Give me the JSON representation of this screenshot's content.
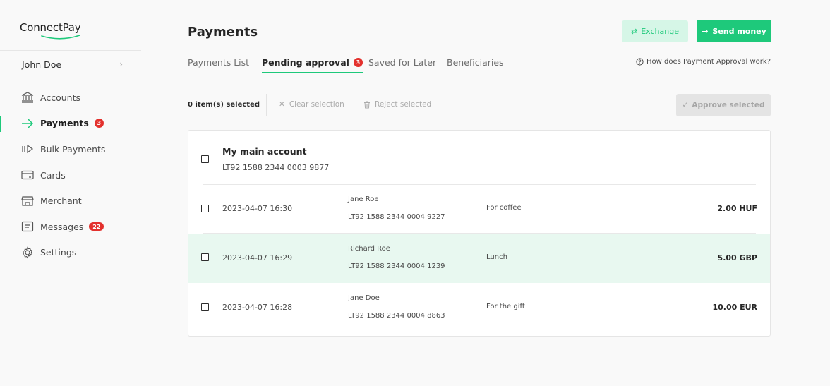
{
  "app": {
    "brand": "ConnectPay"
  },
  "user": {
    "name": "John Doe"
  },
  "sidebar": {
    "items": [
      {
        "label": "Accounts",
        "icon": "bank-icon"
      },
      {
        "label": "Payments",
        "icon": "arrow-right-icon",
        "badge": "3",
        "active": true
      },
      {
        "label": "Bulk Payments",
        "icon": "bulk-arrow-icon"
      },
      {
        "label": "Cards",
        "icon": "card-icon"
      },
      {
        "label": "Merchant",
        "icon": "store-icon"
      },
      {
        "label": "Messages",
        "icon": "message-icon",
        "badge": "22"
      },
      {
        "label": "Settings",
        "icon": "gear-icon"
      }
    ]
  },
  "header": {
    "title": "Payments",
    "exchange_label": "Exchange",
    "send_label": "Send money"
  },
  "tabs": [
    {
      "label": "Payments List"
    },
    {
      "label": "Pending approval",
      "badge": "3",
      "active": true
    },
    {
      "label": "Saved for Later"
    },
    {
      "label": "Beneficiaries"
    }
  ],
  "help_link": "How does Payment Approval work?",
  "toolbar": {
    "selected_count": "0 item(s) selected",
    "clear_label": "Clear selection",
    "reject_label": "Reject selected",
    "approve_label": "Approve selected"
  },
  "account": {
    "name": "My main account",
    "iban": "LT92 1588 2344 0003 9877"
  },
  "payments": [
    {
      "datetime": "2023-04-07 16:30",
      "beneficiary": "Jane Roe",
      "iban": "LT92 1588 2344 0004 9227",
      "description": "For coffee",
      "amount": "2.00 HUF"
    },
    {
      "datetime": "2023-04-07 16:29",
      "beneficiary": "Richard Roe",
      "iban": "LT92 1588 2344 0004 1239",
      "description": "Lunch",
      "amount": "5.00 GBP",
      "highlighted": true
    },
    {
      "datetime": "2023-04-07 16:28",
      "beneficiary": "Jane Doe",
      "iban": "LT92 1588 2344 0004 8863",
      "description": "For the gift",
      "amount": "10.00 EUR"
    }
  ],
  "colors": {
    "accent": "#1ec97b",
    "badge": "#e3312d",
    "highlight_row": "#e8f8f0"
  }
}
